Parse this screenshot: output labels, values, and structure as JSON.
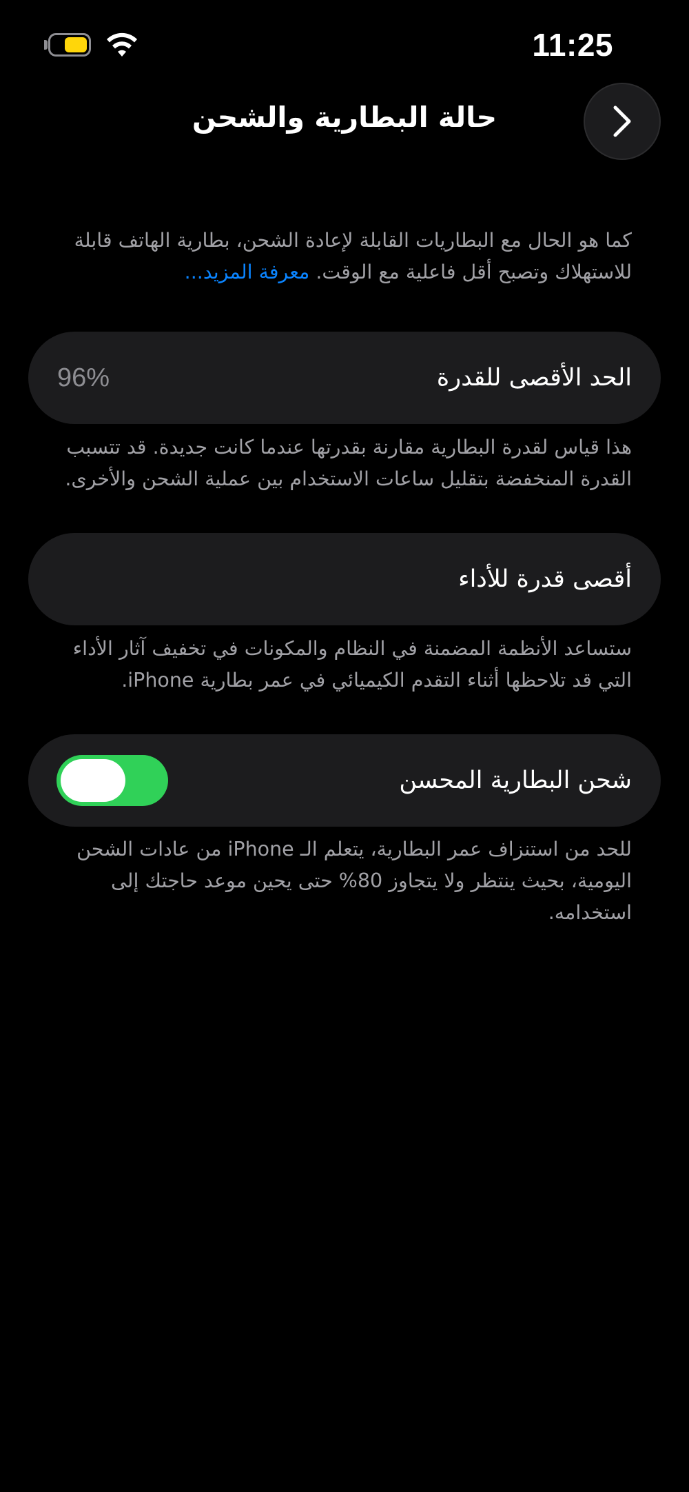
{
  "status_bar": {
    "time": "11:25",
    "battery_icon": "battery-low-power-icon",
    "battery_color": "#ffd60a",
    "wifi_icon": "wifi-icon"
  },
  "header": {
    "title": "حالة البطارية والشحن",
    "back_icon": "chevron-right-icon"
  },
  "intro": {
    "line1": "كما هو الحال مع البطاريات القابلة لإعادة الشحن، بطارية الهاتف قابلة",
    "line2_text": "للاستهلاك وتصبح أقل فاعلية مع الوقت.",
    "link": "معرفة المزيد...",
    "link_color": "#0a84ff"
  },
  "maximum_capacity": {
    "label": "الحد الأقصى للقدرة",
    "value": "96%",
    "note_line1": "هذا قياس لقدرة البطارية مقارنة بقدرتها عندما كانت جديدة. قد تتسبب",
    "note_line2": "القدرة المنخفضة بتقليل ساعات الاستخدام بين عملية الشحن والأخرى."
  },
  "peak_performance": {
    "label": "أقصى قدرة للأداء",
    "note_line1": "ستساعد الأنظمة المضمنة في النظام والمكونات في تخفيف آثار الأداء",
    "note_line2": "التي قد تلاحظها أثناء التقدم الكيميائي في عمر بطارية iPhone."
  },
  "optimized_charging": {
    "label": "شحن البطارية المحسن",
    "enabled": true,
    "toggle_color": "#30d158",
    "note_line1": "للحد من استنزاف عمر البطارية، يتعلم الـ iPhone من عادات الشحن",
    "note_line2": "اليومية، بحيث ينتظر ولا يتجاوز 80% حتى يحين موعد حاجتك إلى",
    "note_line3": "استخدامه."
  }
}
